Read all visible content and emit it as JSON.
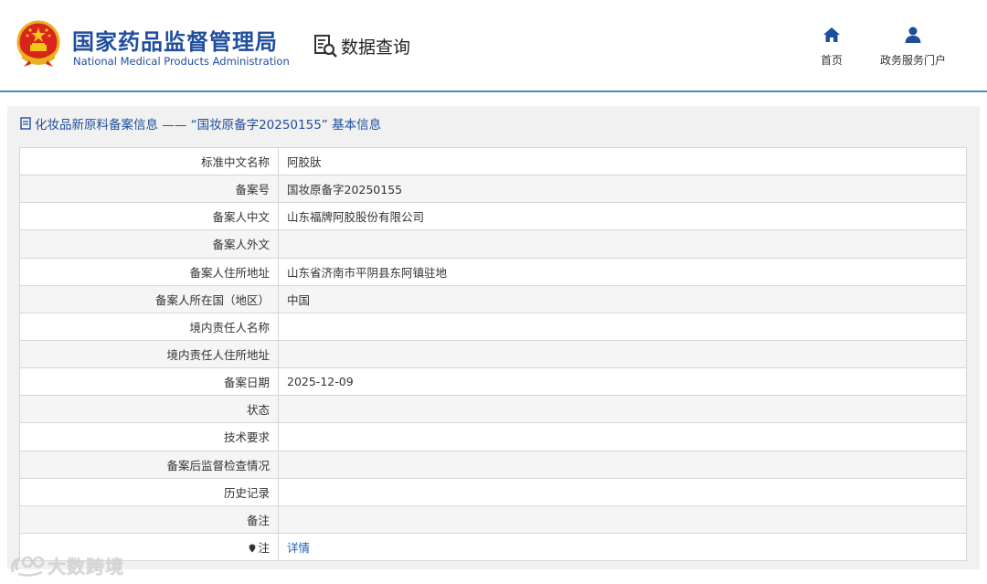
{
  "header": {
    "brand_cn": "国家药品监督管理局",
    "brand_en": "National Medical Products Administration",
    "query_label": "数据查询",
    "nav": [
      {
        "label": "首页",
        "icon": "home-icon"
      },
      {
        "label": "政务服务门户",
        "icon": "user-icon"
      }
    ]
  },
  "panel": {
    "title": "化妆品新原料备案信息 —— “国妆原备字20250155” 基本信息"
  },
  "rows": [
    {
      "label": "标准中文名称",
      "value": "阿胶肽"
    },
    {
      "label": "备案号",
      "value": "国妆原备字20250155"
    },
    {
      "label": "备案人中文",
      "value": "山东福牌阿胶股份有限公司"
    },
    {
      "label": "备案人外文",
      "value": ""
    },
    {
      "label": "备案人住所地址",
      "value": "山东省济南市平阴县东阿镇驻地"
    },
    {
      "label": "备案人所在国（地区）",
      "value": "中国"
    },
    {
      "label": "境内责任人名称",
      "value": ""
    },
    {
      "label": "境内责任人住所地址",
      "value": ""
    },
    {
      "label": "备案日期",
      "value": "2025-12-09"
    },
    {
      "label": "状态",
      "value": ""
    },
    {
      "label": "技术要求",
      "value": ""
    },
    {
      "label": "备案后监督检查情况",
      "value": ""
    },
    {
      "label": "历史记录",
      "value": ""
    },
    {
      "label": "备注",
      "value": ""
    }
  ],
  "note_row": {
    "label": "注",
    "link": "详情"
  },
  "watermark": {
    "text": "大数跨境"
  },
  "colors": {
    "brand": "#1f4e9c",
    "accent_line": "#4a86c8",
    "link": "#1f62b0",
    "panel_bg": "#f1f1f1"
  }
}
